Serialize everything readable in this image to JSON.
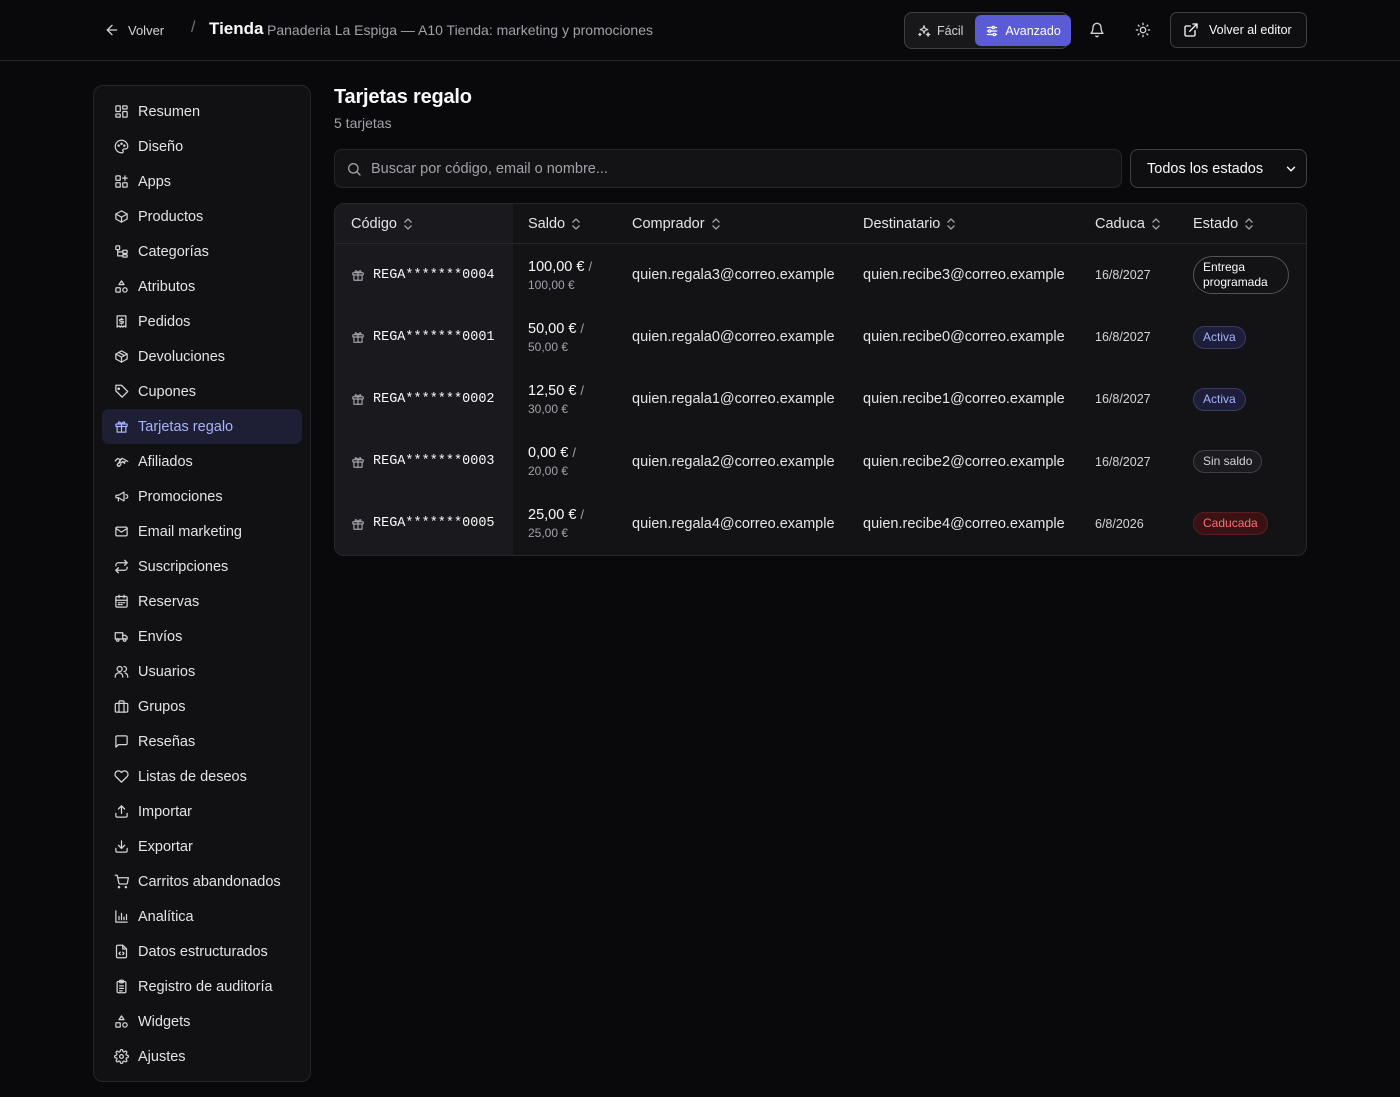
{
  "header": {
    "back_label": "Volver",
    "separator": "/",
    "title": "Tienda",
    "subtitle": "Panaderia La Espiga — A10 Tienda: marketing y promociones",
    "mode_easy": "Fácil",
    "mode_advanced": "Avanzado",
    "editor_label": "Volver al editor"
  },
  "sidebar": {
    "items": [
      {
        "label": "Resumen",
        "icon": "dashboard-icon"
      },
      {
        "label": "Diseño",
        "icon": "palette-icon"
      },
      {
        "label": "Apps",
        "icon": "apps-icon"
      },
      {
        "label": "Productos",
        "icon": "package-icon"
      },
      {
        "label": "Categorías",
        "icon": "category-tree-icon"
      },
      {
        "label": "Atributos",
        "icon": "shapes-icon"
      },
      {
        "label": "Pedidos",
        "icon": "receipt-icon"
      },
      {
        "label": "Devoluciones",
        "icon": "package-return-icon"
      },
      {
        "label": "Cupones",
        "icon": "tag-icon"
      },
      {
        "label": "Tarjetas regalo",
        "icon": "gift-icon"
      },
      {
        "label": "Afiliados",
        "icon": "handshake-icon"
      },
      {
        "label": "Promociones",
        "icon": "megaphone-icon"
      },
      {
        "label": "Email marketing",
        "icon": "mail-icon"
      },
      {
        "label": "Suscripciones",
        "icon": "repeat-icon"
      },
      {
        "label": "Reservas",
        "icon": "calendar-icon"
      },
      {
        "label": "Envíos",
        "icon": "truck-icon"
      },
      {
        "label": "Usuarios",
        "icon": "users-icon"
      },
      {
        "label": "Grupos",
        "icon": "briefcase-icon"
      },
      {
        "label": "Reseñas",
        "icon": "message-square-icon"
      },
      {
        "label": "Listas de deseos",
        "icon": "heart-icon"
      },
      {
        "label": "Importar",
        "icon": "upload-icon"
      },
      {
        "label": "Exportar",
        "icon": "download-icon"
      },
      {
        "label": "Carritos abandonados",
        "icon": "cart-icon"
      },
      {
        "label": "Analítica",
        "icon": "bar-chart-icon"
      },
      {
        "label": "Datos estructurados",
        "icon": "file-code-icon"
      },
      {
        "label": "Registro de auditoría",
        "icon": "clipboard-icon"
      },
      {
        "label": "Widgets",
        "icon": "shapes-icon"
      },
      {
        "label": "Ajustes",
        "icon": "gear-icon"
      }
    ],
    "active_index": 9
  },
  "main": {
    "title": "Tarjetas regalo",
    "subtitle": "5 tarjetas",
    "search_placeholder": "Buscar por código, email o nombre...",
    "filter_selected": "Todos los estados"
  },
  "table": {
    "columns": [
      "Código",
      "Saldo",
      "Comprador",
      "Destinatario",
      "Caduca",
      "Estado"
    ],
    "rows": [
      {
        "code": "REGA*******0004",
        "balance": "100,00 €",
        "total": "100,00 €",
        "buyer": "quien.regala3@correo.example",
        "recipient": "quien.recibe3@correo.example",
        "expires": "16/8/2027",
        "status": "Entrega programada",
        "status_kind": "scheduled"
      },
      {
        "code": "REGA*******0001",
        "balance": "50,00 €",
        "total": "50,00 €",
        "buyer": "quien.regala0@correo.example",
        "recipient": "quien.recibe0@correo.example",
        "expires": "16/8/2027",
        "status": "Activa",
        "status_kind": "active"
      },
      {
        "code": "REGA*******0002",
        "balance": "12,50 €",
        "total": "30,00 €",
        "buyer": "quien.regala1@correo.example",
        "recipient": "quien.recibe1@correo.example",
        "expires": "16/8/2027",
        "status": "Activa",
        "status_kind": "active"
      },
      {
        "code": "REGA*******0003",
        "balance": "0,00 €",
        "total": "20,00 €",
        "buyer": "quien.regala2@correo.example",
        "recipient": "quien.recibe2@correo.example",
        "expires": "16/8/2027",
        "status": "Sin saldo",
        "status_kind": "nobal"
      },
      {
        "code": "REGA*******0005",
        "balance": "25,00 €",
        "total": "25,00 €",
        "buyer": "quien.regala4@correo.example",
        "recipient": "quien.recibe4@correo.example",
        "expires": "6/8/2026",
        "status": "Caducada",
        "status_kind": "expired"
      }
    ]
  },
  "colors": {
    "background": "#09090b",
    "accent": "#5b5bd6",
    "accent_text": "#a5b4fc",
    "expired": "#f87171"
  }
}
